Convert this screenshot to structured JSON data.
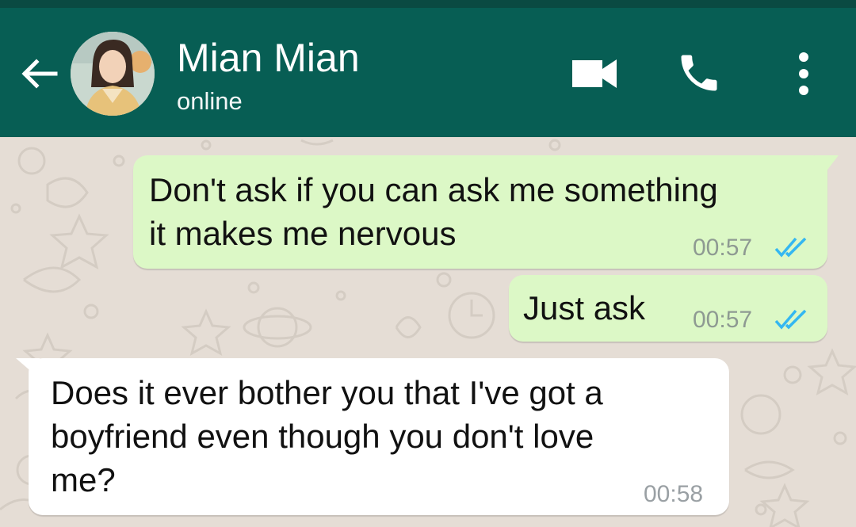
{
  "header": {
    "contact_name": "Mian Mian",
    "status": "online",
    "colors": {
      "bar": "#075e54",
      "strip": "#0a4a42"
    },
    "icons": [
      "back-arrow-icon",
      "video-camera-icon",
      "phone-icon",
      "more-vert-icon"
    ]
  },
  "chat": {
    "wallpaper_color": "#e5ddd5",
    "messages": [
      {
        "direction": "outgoing",
        "lines": [
          "Don't ask if you can ask me something",
          "it makes me nervous"
        ],
        "time": "00:57",
        "read": true
      },
      {
        "direction": "outgoing",
        "lines": [
          "Just ask"
        ],
        "time": "00:57",
        "read": true
      },
      {
        "direction": "incoming",
        "lines": [
          "Does it ever bother you that I've got a",
          "boyfriend even though you don't love",
          "me?"
        ],
        "time": "00:58"
      }
    ],
    "colors": {
      "outgoing": "#dcf8c6",
      "incoming": "#ffffff",
      "read_ticks": "#34b7f1"
    }
  }
}
